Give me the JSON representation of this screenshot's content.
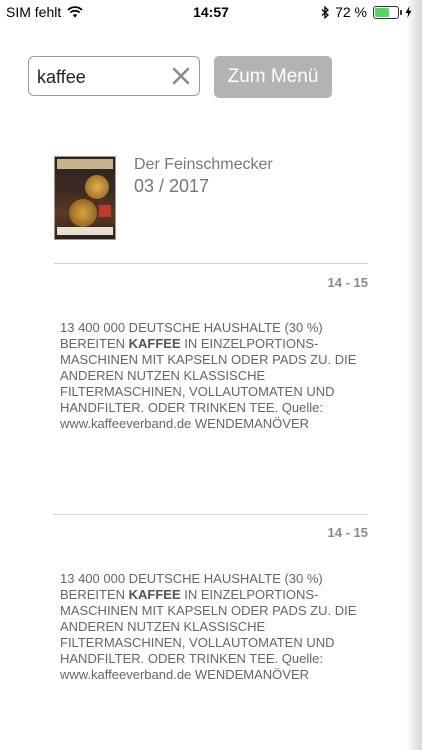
{
  "status_bar": {
    "carrier": "SIM fehlt",
    "time": "14:57",
    "battery_percent": "72 %",
    "battery_level": 0.72,
    "icons": [
      "wifi-icon",
      "bluetooth-icon",
      "battery-icon",
      "charging-icon"
    ]
  },
  "search": {
    "value": "kaffee",
    "placeholder": ""
  },
  "menu_button": {
    "label": "Zum Menü"
  },
  "magazine": {
    "name": "Der Feinschmecker",
    "issue": "03 / 2017"
  },
  "results": [
    {
      "pages": "14 - 15",
      "before": "13 400 000 DEUTSCHE HAUSHALTE (30 %) BEREITEN ",
      "highlight": "KAFFEE",
      "after": " IN EINZELPORTIONS-MASCHINEN MIT KAPSELN ODER PADS ZU. DIE ANDEREN NUTZEN KLASSISCHE FILTERMASCHINEN, VOLLAUTOMATEN UND HANDFILTER. ODER TRINKEN TEE. Quelle: www.kaffeeverband.de WENDEMANÖVER"
    },
    {
      "pages": "14 - 15",
      "before": "13 400 000 DEUTSCHE HAUSHALTE (30 %) BEREITEN ",
      "highlight": "KAFFEE",
      "after": " IN EINZELPORTIONS-MASCHINEN MIT KAPSELN ODER PADS ZU. DIE ANDEREN NUTZEN KLASSISCHE FILTERMASCHINEN, VOLLAUTOMATEN UND HANDFILTER. ODER TRINKEN TEE. Quelle: www.kaffeeverband.de WENDEMANÖVER"
    }
  ],
  "colors": {
    "button_bg": "#b3b3b3",
    "battery_green": "#4cd964",
    "text_grey": "#777777"
  }
}
